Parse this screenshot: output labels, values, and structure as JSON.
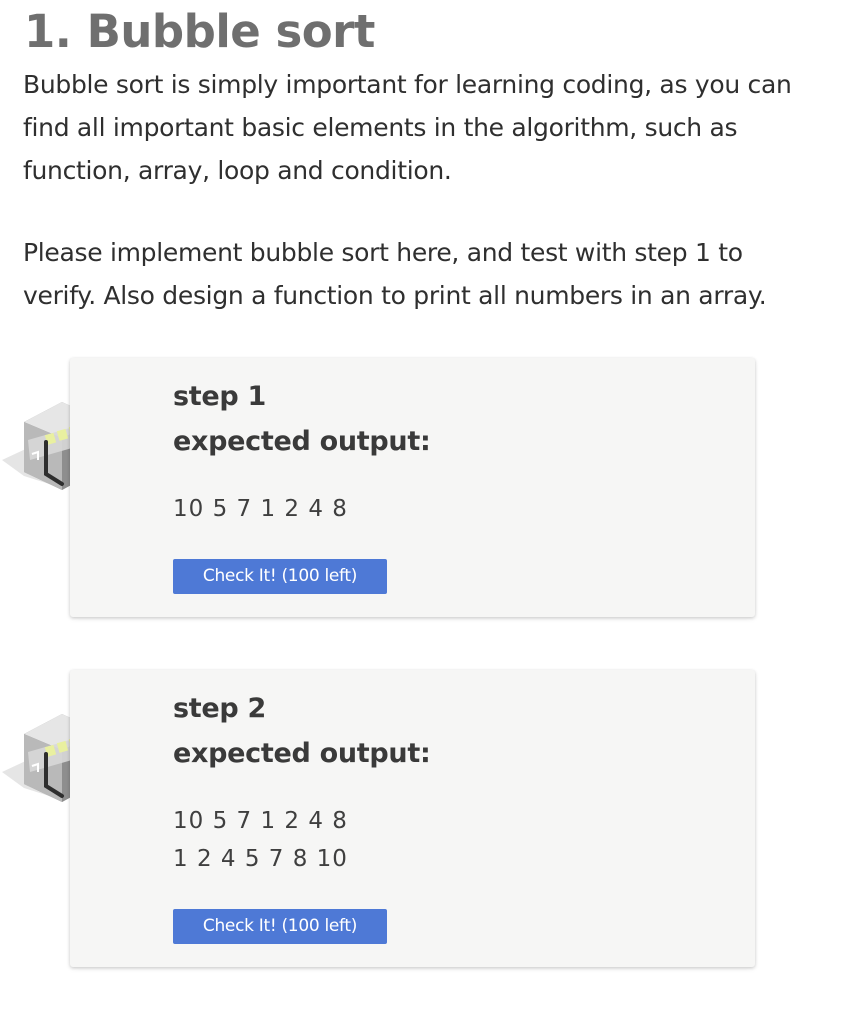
{
  "section": {
    "title": "1. Bubble sort",
    "intro": "Bubble sort is simply important for learning coding, as you can find all important basic elements in the algorithm, such as function, array, loop and condition.",
    "instructions": "Please implement bubble sort here, and test with step 1 to verify. Also design a function to print all numbers in an array."
  },
  "steps": [
    {
      "title": "step 1",
      "expected_label": "expected output:",
      "output_lines": [
        "10 5 7 1 2 4 8"
      ],
      "button_label": "Check It! (100 left)",
      "icon": "cube-icon"
    },
    {
      "title": "step 2",
      "expected_label": "expected output:",
      "output_lines": [
        "10 5 7 1 2 4 8",
        "1 2 4 5 7 8 10"
      ],
      "button_label": "Check It! (100 left)",
      "icon": "cube-icon"
    }
  ],
  "colors": {
    "button": "#4e79d6",
    "card_background": "#f6f6f5",
    "heading": "#6f6f6f"
  }
}
